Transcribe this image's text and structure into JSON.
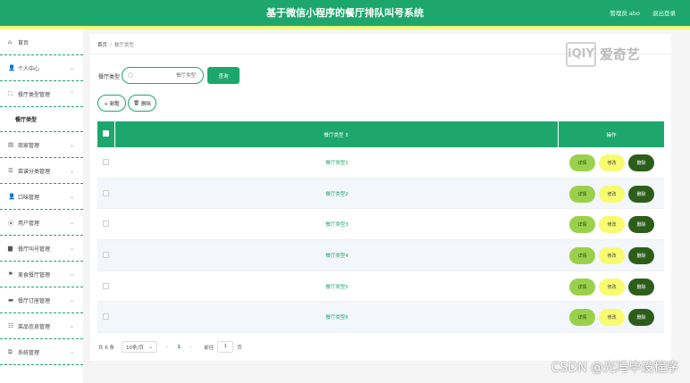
{
  "header": {
    "title": "基于微信小程序的餐厅排队叫号系统",
    "user": "管理员 abo",
    "logout": "退出登录"
  },
  "sidebar": {
    "items": [
      {
        "label": "首页",
        "icon": "home-icon",
        "glyph": "⌂",
        "chevron": false
      },
      {
        "label": "个人中心",
        "icon": "user-icon",
        "glyph": "👤",
        "chevron": true
      },
      {
        "label": "餐厅类型管理",
        "icon": "expand-icon",
        "glyph": "⛶",
        "chevron": true
      },
      {
        "label": "商家管理",
        "icon": "document-icon",
        "glyph": "▤",
        "chevron": true
      },
      {
        "label": "菜谱分类管理",
        "icon": "list-icon",
        "glyph": "☰",
        "chevron": true
      },
      {
        "label": "口味管理",
        "icon": "user-icon",
        "glyph": "👤",
        "chevron": true
      },
      {
        "label": "用户管理",
        "icon": "location-icon",
        "glyph": "⦿",
        "chevron": true
      },
      {
        "label": "餐厅叫号管理",
        "icon": "printer-icon",
        "glyph": "▆",
        "chevron": true
      },
      {
        "label": "美食餐厅管理",
        "icon": "flag-icon",
        "glyph": "⚑",
        "chevron": true
      },
      {
        "label": "餐厅订座管理",
        "icon": "monitor-icon",
        "glyph": "▬",
        "chevron": true
      },
      {
        "label": "菜品信息管理",
        "icon": "sliders-icon",
        "glyph": "☷",
        "chevron": true
      },
      {
        "label": "系统管理",
        "icon": "copy-icon",
        "glyph": "⧉",
        "chevron": true
      }
    ],
    "sub_item": "餐厅类型"
  },
  "breadcrumb": {
    "home": "首页",
    "sep": "/",
    "current": "餐厅类型"
  },
  "search": {
    "label": "餐厅类型",
    "placeholder": "餐厅类型",
    "button": "查询"
  },
  "toolbar": {
    "add": "+ 新增",
    "delete": "删除"
  },
  "table": {
    "columns": {
      "type": "餐厅类型 ⇕",
      "ops": "操作"
    },
    "rows": [
      {
        "type": "餐厅类型1"
      },
      {
        "type": "餐厅类型2"
      },
      {
        "type": "餐厅类型3"
      },
      {
        "type": "餐厅类型4"
      },
      {
        "type": "餐厅类型5"
      },
      {
        "type": "餐厅类型6"
      }
    ],
    "actions": {
      "detail": "详情",
      "edit": "修改",
      "delete": "删除"
    }
  },
  "pagination": {
    "total": "共 6 条",
    "page_size": "10条/页",
    "prev": "‹",
    "current": "1",
    "next": "›",
    "goto": "前往",
    "goto_value": "1",
    "unit": "页"
  },
  "watermarks": {
    "logo_box": "iQIY",
    "logo_text": "爱奇艺",
    "csdn": "CSDN @光冯毕设程序"
  },
  "colors": {
    "primary": "#1ea76d",
    "strip": "#eefc7a",
    "detail": "#9bd14a",
    "edit": "#f8fb70",
    "delete": "#2c5e1a"
  }
}
